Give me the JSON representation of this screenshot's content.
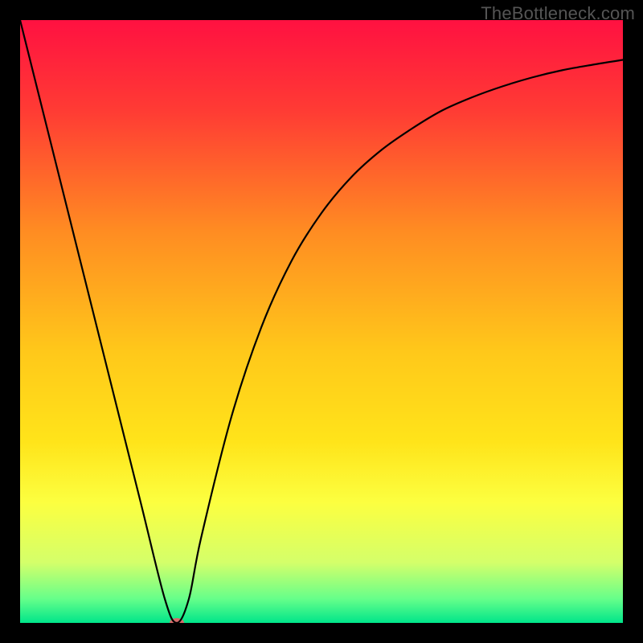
{
  "watermark": "TheBottleneck.com",
  "chart_data": {
    "type": "line",
    "title": "",
    "xlabel": "",
    "ylabel": "",
    "xlim": [
      0,
      100
    ],
    "ylim": [
      0,
      100
    ],
    "grid": false,
    "legend": false,
    "gradient_stops": [
      {
        "offset": 0,
        "color": "#ff1141"
      },
      {
        "offset": 15,
        "color": "#ff3b34"
      },
      {
        "offset": 35,
        "color": "#ff8c22"
      },
      {
        "offset": 55,
        "color": "#ffc81a"
      },
      {
        "offset": 70,
        "color": "#ffe41a"
      },
      {
        "offset": 80,
        "color": "#fcff40"
      },
      {
        "offset": 90,
        "color": "#d4ff6a"
      },
      {
        "offset": 96,
        "color": "#66ff8a"
      },
      {
        "offset": 100,
        "color": "#00e58a"
      }
    ],
    "series": [
      {
        "name": "bottleneck-curve",
        "x": [
          0,
          5,
          10,
          15,
          20,
          24,
          26,
          28,
          30,
          35,
          40,
          45,
          50,
          55,
          60,
          65,
          70,
          75,
          80,
          85,
          90,
          95,
          100
        ],
        "y": [
          100,
          80,
          60,
          40,
          20,
          4,
          0,
          4,
          14,
          34,
          49,
          60,
          68,
          74,
          78.5,
          82,
          85,
          87.2,
          89,
          90.5,
          91.7,
          92.6,
          93.4
        ]
      }
    ],
    "marker": {
      "x": 26,
      "y": 0,
      "color": "#d46a6a",
      "rx": 9,
      "ry": 6
    },
    "annotations": []
  }
}
